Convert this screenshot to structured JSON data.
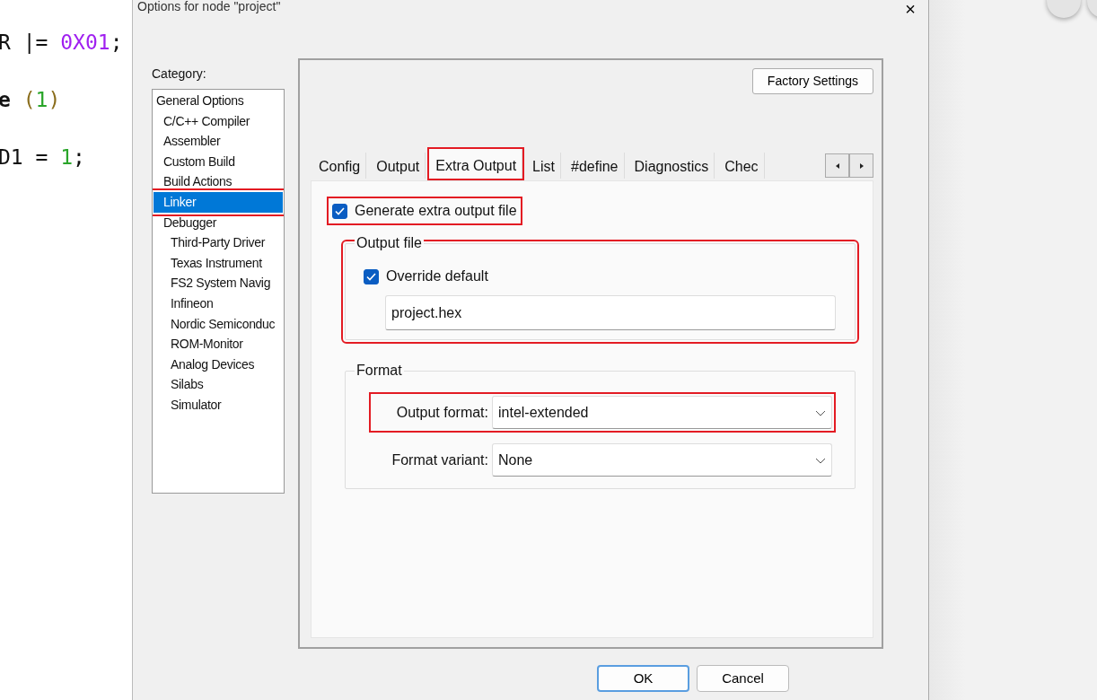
{
  "editor": {
    "lines": [
      {
        "tokens": [
          {
            "text": "R |= ",
            "kind": "plain"
          },
          {
            "text": "0X01",
            "kind": "hex"
          },
          {
            "text": ";",
            "kind": "plain"
          }
        ]
      },
      {
        "tokens": [
          {
            "text": "e",
            "kind": "keyword"
          },
          {
            "text": " (",
            "kind": "bracket"
          },
          {
            "text": "1",
            "kind": "number"
          },
          {
            "text": ")",
            "kind": "bracket"
          }
        ]
      },
      {
        "tokens": [
          {
            "text": "D1 = ",
            "kind": "plain"
          },
          {
            "text": "1",
            "kind": "number"
          },
          {
            "text": ";",
            "kind": "plain"
          }
        ]
      }
    ]
  },
  "dialog": {
    "title": "Options for node \"project\"",
    "close": "×",
    "category": {
      "label": "Category:",
      "items": [
        {
          "label": "General Options",
          "selected": false,
          "annotated": false,
          "children": [
            {
              "label": "C/C++ Compiler",
              "selected": false,
              "annotated": false
            },
            {
              "label": "Assembler",
              "selected": false,
              "annotated": false
            },
            {
              "label": "Custom Build",
              "selected": false,
              "annotated": false
            },
            {
              "label": "Build Actions",
              "selected": false,
              "annotated": false
            },
            {
              "label": "Linker",
              "selected": true,
              "annotated": true
            },
            {
              "label": "Debugger",
              "selected": false,
              "annotated": false,
              "children": [
                {
                  "label": "Third-Party Driver",
                  "selected": false,
                  "annotated": false
                },
                {
                  "label": "Texas Instrument",
                  "selected": false,
                  "annotated": false
                },
                {
                  "label": "FS2 System Navig",
                  "selected": false,
                  "annotated": false
                },
                {
                  "label": "Infineon",
                  "selected": false,
                  "annotated": false
                },
                {
                  "label": "Nordic Semiconduc",
                  "selected": false,
                  "annotated": false
                },
                {
                  "label": "ROM-Monitor",
                  "selected": false,
                  "annotated": false
                },
                {
                  "label": "Analog Devices",
                  "selected": false,
                  "annotated": false
                },
                {
                  "label": "Silabs",
                  "selected": false,
                  "annotated": false
                },
                {
                  "label": "Simulator",
                  "selected": false,
                  "annotated": false
                }
              ]
            }
          ]
        }
      ]
    },
    "factory_settings": "Factory Settings",
    "tabs": [
      {
        "label": "Config",
        "selected": false,
        "annotated": false
      },
      {
        "label": "Output",
        "selected": false,
        "annotated": false
      },
      {
        "label": "Extra Output",
        "selected": true,
        "annotated": true
      },
      {
        "label": "List",
        "selected": false,
        "annotated": false
      },
      {
        "label": "#define",
        "selected": false,
        "annotated": false
      },
      {
        "label": "Diagnostics",
        "selected": false,
        "annotated": false
      },
      {
        "label": "Chec",
        "selected": false,
        "annotated": false
      }
    ],
    "generate": {
      "label": "Generate extra output file",
      "checked": true,
      "annotated": true
    },
    "output_file": {
      "title": "Output file",
      "annotated": true,
      "override": {
        "label": "Override default",
        "checked": true
      },
      "value": "project.hex"
    },
    "format": {
      "title": "Format",
      "fields": [
        {
          "label": "Output format:",
          "value": "intel-extended",
          "annotated": true
        },
        {
          "label": "Format variant:",
          "value": "None",
          "annotated": false
        }
      ]
    },
    "buttons": [
      {
        "label": "OK",
        "default": true
      },
      {
        "label": "Cancel",
        "default": false
      }
    ]
  }
}
